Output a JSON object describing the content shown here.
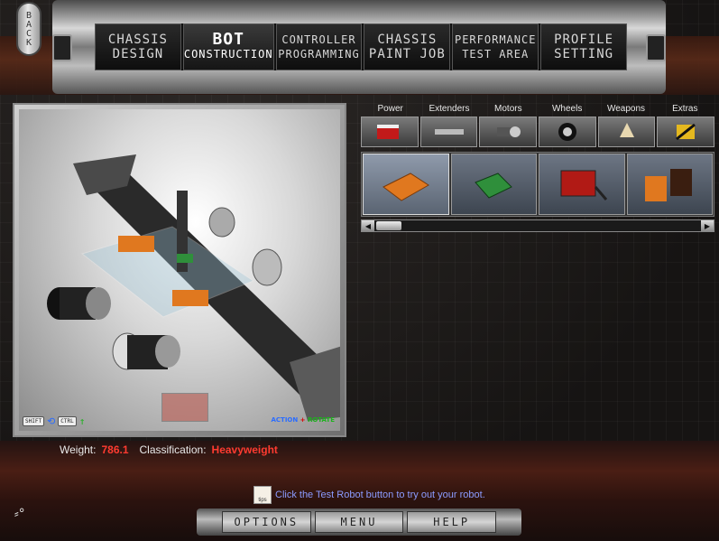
{
  "back": {
    "label": "BACK"
  },
  "nav": {
    "tabs": [
      {
        "line1": "CHASSIS",
        "line2": "DESIGN"
      },
      {
        "line1": "BOT",
        "line2": "CONSTRUCTION"
      },
      {
        "line1": "CONTROLLER",
        "line2": "PROGRAMMING"
      },
      {
        "line1": "CHASSIS",
        "line2": "PAINT JOB"
      },
      {
        "line1": "PERFORMANCE",
        "line2": "TEST AREA"
      },
      {
        "line1": "PROFILE",
        "line2": "SETTING"
      }
    ],
    "active_index": 1
  },
  "viewport": {
    "shift_key": "SHIFT",
    "ctrl_key": "CTRL",
    "action_text": "ACTION",
    "rotate_text": "ROTATE"
  },
  "stats": {
    "weight_label": "Weight:",
    "weight_value": "786.1",
    "class_label": "Classification:",
    "class_value": "Heavyweight"
  },
  "categories": [
    {
      "label": "Power",
      "icon": "battery-icon"
    },
    {
      "label": "Extenders",
      "icon": "extender-bar-icon"
    },
    {
      "label": "Motors",
      "icon": "motor-icon"
    },
    {
      "label": "Wheels",
      "icon": "wheel-icon"
    },
    {
      "label": "Weapons",
      "icon": "weapon-icon"
    },
    {
      "label": "Extras",
      "icon": "extras-icon"
    }
  ],
  "parts": [
    {
      "name": "orange-battery-pack"
    },
    {
      "name": "green-circuit-board"
    },
    {
      "name": "red-battery-with-cable"
    },
    {
      "name": "orange-battery-cluster"
    }
  ],
  "colors": {
    "accent_red": "#ff3b30",
    "tip_blue": "#8b9bff"
  },
  "tip": {
    "icon_label": "tips",
    "text": "Click the Test Robot button to try out your robot."
  },
  "bottom": {
    "options": "OPTIONS",
    "menu": "MENU",
    "help": "HELP"
  }
}
